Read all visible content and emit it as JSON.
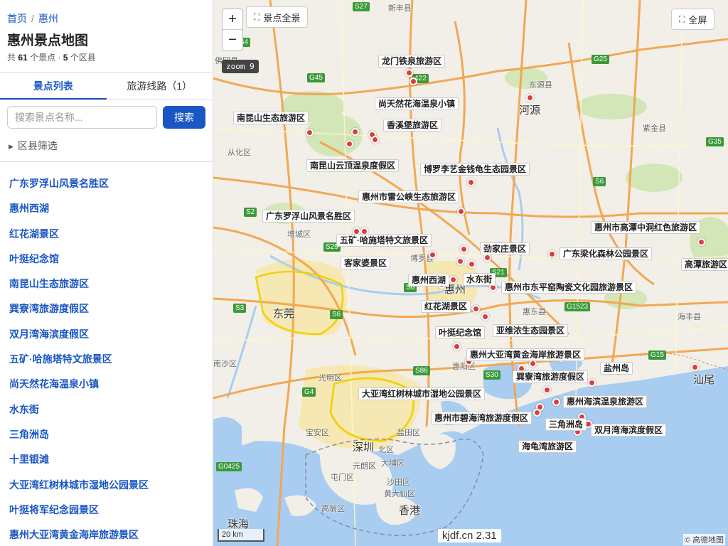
{
  "breadcrumb": {
    "home": "首页",
    "current": "惠州",
    "sep": "/"
  },
  "page": {
    "title": "惠州景点地图"
  },
  "stats": {
    "prefix": "共",
    "spots_count": "61",
    "spots_unit": "个景点 ·",
    "district_count": "5",
    "district_unit": "个区县"
  },
  "tabs": {
    "spots": "景点列表",
    "routes": "旅游线路（1）"
  },
  "search": {
    "placeholder": "搜索景点名称...",
    "button": "搜索"
  },
  "filter": {
    "label": "区县筛选",
    "arrow": "▶"
  },
  "spots": [
    "广东罗浮山风景名胜区",
    "惠州西湖",
    "红花湖景区",
    "叶挺纪念馆",
    "南昆山生态旅游区",
    "巽寮湾旅游度假区",
    "双月湾海滨度假区",
    "五矿·哈施塔特文旅景区",
    "尚天然花海温泉小镇",
    "水东街",
    "三角洲岛",
    "十里银滩",
    "大亚湾红树林城市湿地公园景区",
    "叶挺将军纪念园景区",
    "惠州大亚湾黄金海岸旅游景区"
  ],
  "map": {
    "zoom_in": "+",
    "zoom_out": "−",
    "zoom_badge": "zoom 9",
    "fit_all": "景点全景",
    "fullscreen": "全屏",
    "scale": "20 km",
    "watermark": "kjdf.cn 2.31",
    "copyright": "© 高德地图",
    "labels": {
      "longmen": "龙门铁泉旅游区",
      "shangtianran": "尚天然花海温泉小镇",
      "xiangxibao": "香溪堡旅游区",
      "nankunshan": "南昆山生态旅游区",
      "nankunshan_yunding": "南昆山云顶温泉度假区",
      "boluo_lijin": "博罗李艺金钱龟生态园景区",
      "leigongxia": "惠州市雷公峡生态旅游区",
      "luofushan": "广东罗浮山风景名胜区",
      "hashitate": "五矿·哈施塔特文旅景区",
      "kejiapo": "客家婆景区",
      "jinzhuang": "劲家庄景区",
      "liangsen": "广东梁化森林公园景区",
      "gaotan_hongse": "惠州市高潭中洞红色旅游区",
      "gaotan": "高潭旅游区",
      "xihu": "惠州西湖",
      "shuidongjie": "水东街",
      "dongping": "惠州市东平窑陶瓷文化园旅游景区",
      "honghuahu": "红花湖景区",
      "yeting": "叶挺纪念馆",
      "yaweinong": "亚维浓生态园景区",
      "huangjin": "惠州大亚湾黄金海岸旅游景区",
      "yanzhoudao": "盐州岛",
      "xunliao": "巽寮湾旅游度假区",
      "hongshulin": "大亚湾红树林城市湿地公园景区",
      "haibin": "惠州海滨温泉旅游区",
      "biyuwan": "惠州市碧海湾旅游度假区",
      "sanjiaozhou": "三角洲岛",
      "shuangyue": "双月湾海滨度假区",
      "haiguiwan": "海龟湾旅游区"
    },
    "cities": {
      "heyuan": "河源",
      "dongguan": "东莞",
      "huizhou": "惠州",
      "shenzhen": "深圳",
      "xianggang": "香港",
      "zhuhai": "珠海",
      "shanwei": "汕尾"
    },
    "districts": {
      "xinfeng": "新丰县",
      "dongyuan": "东源县",
      "zijin": "紫金县",
      "conghua": "从化区",
      "zengcheng": "增城区",
      "boluo": "博罗县",
      "huidong": "惠东县",
      "haifeng": "海丰县",
      "huiyang": "惠阳区",
      "guangming": "光明区",
      "baoan": "宝安区",
      "yantian": "盐田区",
      "beiqu": "北区",
      "dapu": "大埔区",
      "yuanlang": "元朗区",
      "tunmen": "屯门区",
      "shatian": "沙田区",
      "huangdaxian": "黄大仙区",
      "gaoshan": "高翁区",
      "nansha": "南沙区",
      "fogang": "佛冈县"
    },
    "highways": [
      "S27",
      "G45",
      "G25",
      "G35",
      "S6",
      "S2",
      "S29",
      "S3",
      "S6",
      "G1523",
      "G15",
      "G4",
      "S86",
      "S30",
      "G0425",
      "S4",
      "S21",
      "S6",
      "422"
    ]
  },
  "colors": {
    "accent": "#1a56c4",
    "marker": "#e03c3c",
    "water": "#a9cdf0",
    "land": "#f2efe9",
    "green": "#cfe6b3"
  }
}
